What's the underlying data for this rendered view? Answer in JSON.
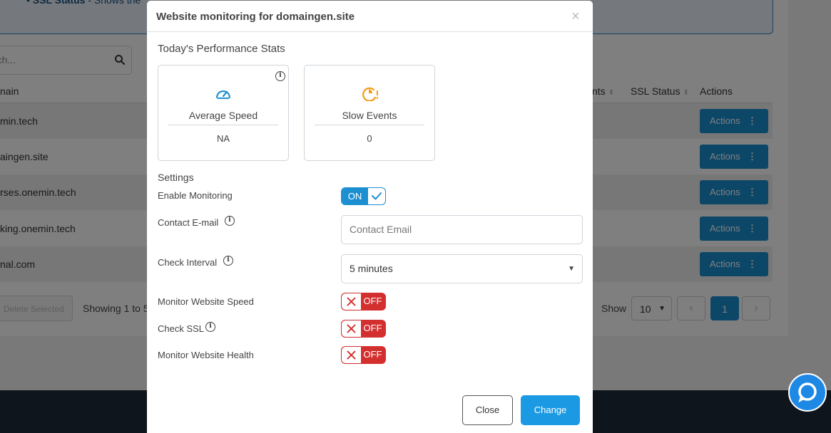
{
  "background": {
    "info": {
      "bold": "SSL Status",
      "text": " - Shows the"
    },
    "search": {
      "placeholder": "rch..."
    },
    "table": {
      "headers": {
        "domain": "nain",
        "events": "nts",
        "ssl": "SSL Status",
        "actions": "Actions"
      },
      "rows": [
        {
          "domain": "min.tech",
          "action": "Actions"
        },
        {
          "domain": "aingen.site",
          "action": "Actions"
        },
        {
          "domain": "rses.onemin.tech",
          "action": "Actions"
        },
        {
          "domain": "king.onemin.tech",
          "action": "Actions"
        },
        {
          "domain": "nal.com",
          "action": "Actions"
        }
      ]
    },
    "footer": {
      "delete_label": "Delete Selected",
      "showing": "Showing 1 to 5",
      "show_label": "Show",
      "page_size": "10",
      "current_page": "1"
    }
  },
  "modal": {
    "title": "Website monitoring for domaingen.site",
    "close_glyph": "×",
    "stats_heading": "Today's Performance Stats",
    "stats": [
      {
        "label": "Average Speed",
        "value": "NA",
        "icon": "gauge-icon",
        "color": "#1b8fd0"
      },
      {
        "label": "Slow Events",
        "value": "0",
        "icon": "slow-clock-icon",
        "color": "#f39c12"
      }
    ],
    "settings_heading": "Settings",
    "settings": {
      "enable_monitoring": {
        "label": "Enable Monitoring",
        "state": "ON"
      },
      "contact_email": {
        "label": "Contact E-mail",
        "placeholder": "Contact Email"
      },
      "check_interval": {
        "label": "Check Interval",
        "value": "5 minutes"
      },
      "monitor_speed": {
        "label": "Monitor Website Speed",
        "state": "OFF"
      },
      "check_ssl": {
        "label": "Check SSL",
        "state": "OFF"
      },
      "monitor_health": {
        "label": "Monitor Website Health",
        "state": "OFF"
      }
    },
    "buttons": {
      "close": "Close",
      "change": "Change"
    }
  },
  "colors": {
    "primary": "#1b8fd0",
    "danger": "#d32f2f",
    "warning": "#f39c12"
  }
}
